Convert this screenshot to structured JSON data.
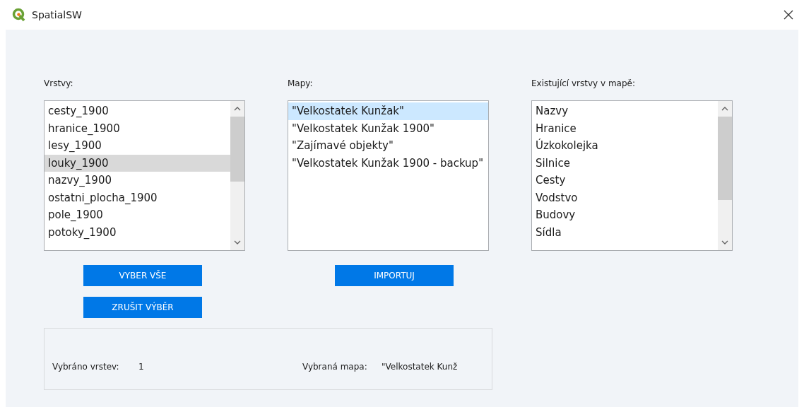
{
  "window": {
    "title": "SpatialSW"
  },
  "layers": {
    "label": "Vrstvy:",
    "items": [
      {
        "text": "cesty_1900",
        "selected": false
      },
      {
        "text": "hranice_1900",
        "selected": false
      },
      {
        "text": "lesy_1900",
        "selected": false
      },
      {
        "text": "louky_1900",
        "selected": true
      },
      {
        "text": "nazvy_1900",
        "selected": false
      },
      {
        "text": "ostatni_plocha_1900",
        "selected": false
      },
      {
        "text": "pole_1900",
        "selected": false
      },
      {
        "text": "potoky_1900",
        "selected": false
      }
    ]
  },
  "maps": {
    "label": "Mapy:",
    "items": [
      {
        "text": "\"Velkostatek Kunžak\"",
        "selected": true
      },
      {
        "text": "\"Velkostatek Kunžak 1900\"",
        "selected": false
      },
      {
        "text": "\"Zajímavé objekty\"",
        "selected": false
      },
      {
        "text": "\"Velkostatek Kunžak 1900 - backup\"",
        "selected": false
      }
    ]
  },
  "existing": {
    "label": "Existující vrstvy v mapě:",
    "items": [
      {
        "text": "Nazvy",
        "selected": false
      },
      {
        "text": "Hranice",
        "selected": false
      },
      {
        "text": "Úzkokolejka",
        "selected": false
      },
      {
        "text": "Silnice",
        "selected": false
      },
      {
        "text": "Cesty",
        "selected": false
      },
      {
        "text": "Vodstvo",
        "selected": false
      },
      {
        "text": "Budovy",
        "selected": false
      },
      {
        "text": "Sídla",
        "selected": false
      }
    ]
  },
  "buttons": {
    "select_all": "VYBER VŠE",
    "clear_selection": "ZRUŠIT VÝBĚR",
    "import": "IMPORTUJ"
  },
  "summary": {
    "layers_label": "Vybráno vrstev:",
    "layers_value": "1",
    "map_label": "Vybraná mapa:",
    "map_value": "\"Velkostatek Kunž"
  }
}
